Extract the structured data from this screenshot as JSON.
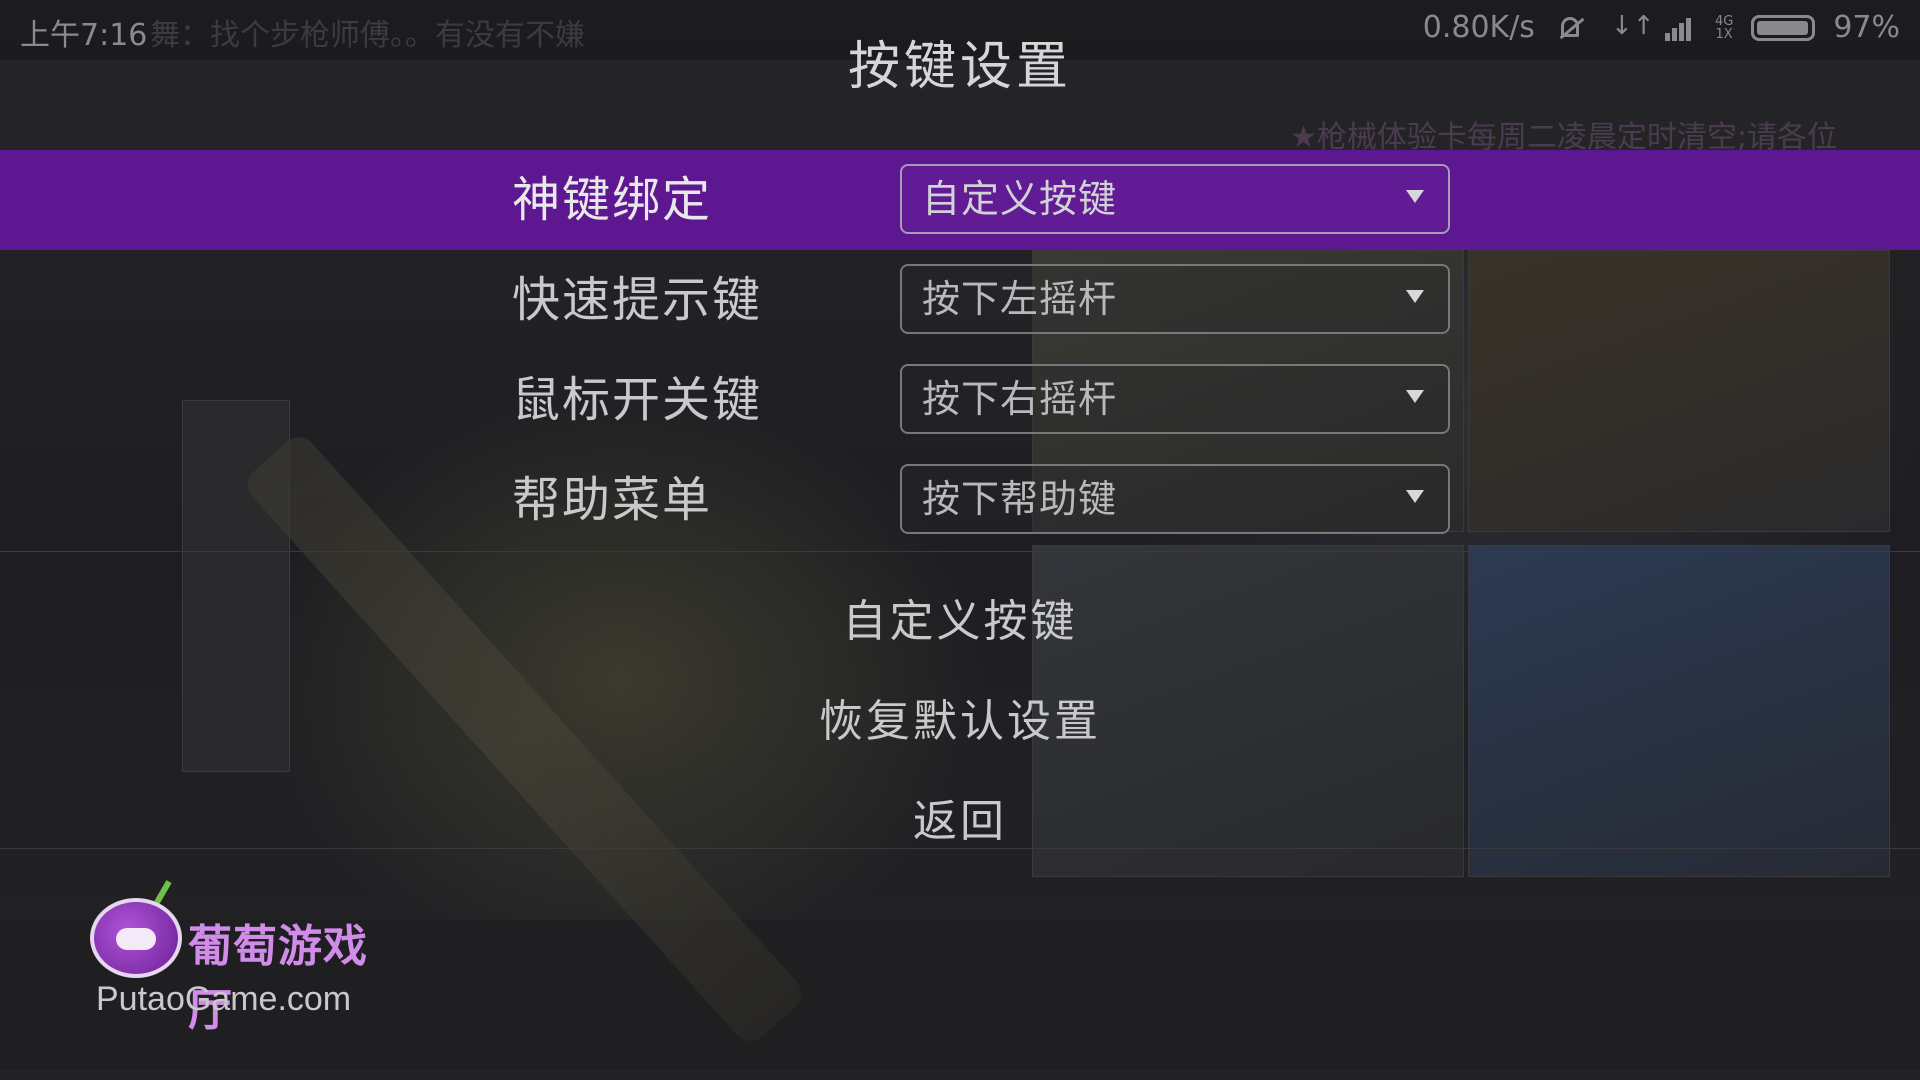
{
  "status_bar": {
    "time": "上午7:16",
    "background_text": "舞：找个步枪师傅。。有没有不嫌",
    "network_speed": "0.80K/s",
    "network_type_top": "4G",
    "network_type_bottom": "1X",
    "battery_percent": "97%",
    "battery_level": 0.97,
    "icons": [
      "mute-icon",
      "data-activity-icon",
      "signal-icon",
      "battery-icon"
    ]
  },
  "background_game": {
    "ticker_text": "★枪械体验卡每周二凌晨定时清空;请各位"
  },
  "dialog": {
    "title": "按键设置",
    "settings": [
      {
        "label": "神键绑定",
        "value": "自定义按键",
        "selected": true
      },
      {
        "label": "快速提示键",
        "value": "按下左摇杆",
        "selected": false
      },
      {
        "label": "鼠标开关键",
        "value": "按下右摇杆",
        "selected": false
      },
      {
        "label": "帮助菜单",
        "value": "按下帮助键",
        "selected": false
      }
    ],
    "actions": {
      "custom_keys": "自定义按键",
      "restore_defaults": "恢复默认设置",
      "back": "返回"
    }
  },
  "colors": {
    "selected_row": "#5d1790",
    "text": "#c9c9cc",
    "watermark_brand": "#d08ce8"
  },
  "watermark": {
    "brand": "葡萄游戏厅",
    "url": "PutaoGame.com"
  }
}
